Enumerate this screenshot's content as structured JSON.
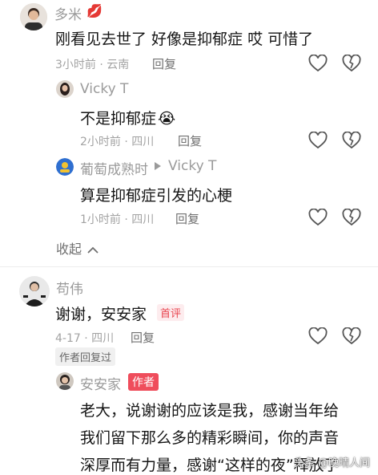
{
  "comments": [
    {
      "user": "多米",
      "text": "刚看见去世了 好像是抑郁症 哎 可惜了",
      "meta": "3小时前 · 云南",
      "reply_label": "回复",
      "replies": [
        {
          "user": "Vicky T",
          "text": "不是抑郁症",
          "emoji": "😭",
          "meta": "2小时前 · 四川",
          "reply_label": "回复"
        },
        {
          "user": "葡萄成熟时",
          "reply_to": "Vicky T",
          "text": "算是抑郁症引发的心梗",
          "meta": "1小时前 · 四川",
          "reply_label": "回复"
        }
      ],
      "collapse_label": "收起"
    },
    {
      "user": "苟伟",
      "text": "谢谢，安安家",
      "badge": "首评",
      "meta": "4-17 · 四川",
      "reply_label": "回复",
      "author_replied": "作者回复过",
      "replies": [
        {
          "user": "安安家",
          "author_badge": "作者",
          "lines": [
            "老大，说谢谢的应该是我，感谢当年给",
            "我们留下那么多的精彩瞬间，你的声音",
            "深厚而有力量，感谢“这样的夜”释放了"
          ]
        }
      ]
    }
  ],
  "watermark": "头条 @晚晴人间",
  "colors": {
    "red_badge": "#e8454f",
    "author_badge": "#ef4d5c",
    "meta": "#a3a3a3"
  }
}
